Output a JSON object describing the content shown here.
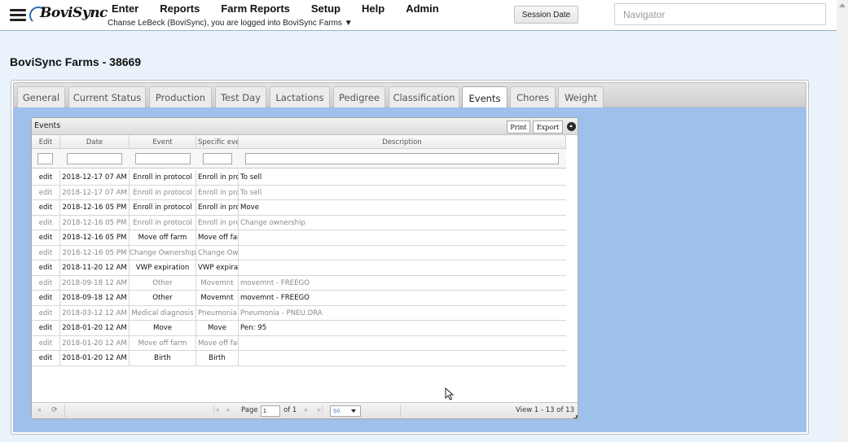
{
  "app": {
    "logo_text": "BoviSync",
    "menu": [
      "Enter",
      "Reports",
      "Farm Reports",
      "Setup",
      "Help",
      "Admin"
    ],
    "login_info": "Chanse LeBeck (BoviSync), you are logged into BoviSync Farms ▼",
    "session_date_label": "Session Date",
    "navigator_placeholder": "Navigator"
  },
  "page": {
    "title": "BoviSync Farms - 38669"
  },
  "tabs": [
    {
      "label": "General",
      "active": false
    },
    {
      "label": "Current Status",
      "active": false
    },
    {
      "label": "Production",
      "active": false
    },
    {
      "label": "Test Day",
      "active": false
    },
    {
      "label": "Lactations",
      "active": false
    },
    {
      "label": "Pedigree",
      "active": false
    },
    {
      "label": "Classification",
      "active": false
    },
    {
      "label": "Events",
      "active": true
    },
    {
      "label": "Chores",
      "active": false
    },
    {
      "label": "Weight",
      "active": false
    }
  ],
  "grid": {
    "title": "Events",
    "print_label": "Print",
    "export_label": "Export",
    "columns": [
      "Edit",
      "Date",
      "Event",
      "Specific eve",
      "Description"
    ],
    "rows": [
      {
        "edit": "edit",
        "date": "2018-12-17 07 AM",
        "event": "Enroll in protocol",
        "specific": "Enroll in pro",
        "description": "To sell",
        "dim": false
      },
      {
        "edit": "edit",
        "date": "2018-12-17 07 AM",
        "event": "Enroll in protocol",
        "specific": "Enroll in pro",
        "description": "To sell",
        "dim": true
      },
      {
        "edit": "edit",
        "date": "2018-12-16 05 PM",
        "event": "Enroll in protocol",
        "specific": "Enroll in pro",
        "description": "Move",
        "dim": false
      },
      {
        "edit": "edit",
        "date": "2018-12-16 05 PM",
        "event": "Enroll in protocol",
        "specific": "Enroll in pro",
        "description": "Change ownership",
        "dim": true
      },
      {
        "edit": "edit",
        "date": "2018-12-16 05 PM",
        "event": "Move off farm",
        "specific": "Move off far",
        "description": "",
        "dim": false
      },
      {
        "edit": "edit",
        "date": "2018-12-16 05 PM",
        "event": "Change Ownership",
        "specific": "Change Own",
        "description": "",
        "dim": true
      },
      {
        "edit": "edit",
        "date": "2018-11-20 12 AM",
        "event": "VWP expiration",
        "specific": "VWP expirat",
        "description": "",
        "dim": false
      },
      {
        "edit": "edit",
        "date": "2018-09-18 12 AM",
        "event": "Other",
        "specific": "Movemnt",
        "description": "movemnt - FREEGO",
        "dim": true
      },
      {
        "edit": "edit",
        "date": "2018-09-18 12 AM",
        "event": "Other",
        "specific": "Movemnt",
        "description": "movemnt - FREEGO",
        "dim": false
      },
      {
        "edit": "edit",
        "date": "2018-03-12 12 AM",
        "event": "Medical diagnosis",
        "specific": "Pneumonia",
        "description": "Pneumonia - PNEU.DRA",
        "dim": true
      },
      {
        "edit": "edit",
        "date": "2018-01-20 12 AM",
        "event": "Move",
        "specific": "Move",
        "description": "Pen: 95",
        "dim": false
      },
      {
        "edit": "edit",
        "date": "2018-01-20 12 AM",
        "event": "Move off farm",
        "specific": "Move off far",
        "description": "",
        "dim": true
      },
      {
        "edit": "edit",
        "date": "2018-01-20 12 AM",
        "event": "Birth",
        "specific": "Birth",
        "description": "",
        "dim": false
      }
    ],
    "pager": {
      "page_label": "Page",
      "page_value": "1",
      "of_label": "of 1",
      "rows_per_page": "50",
      "view_text": "View 1 - 13 of 13"
    }
  },
  "colors": {
    "panel_bg": "#9ec0eb",
    "page_bg": "#eaf3fb"
  }
}
